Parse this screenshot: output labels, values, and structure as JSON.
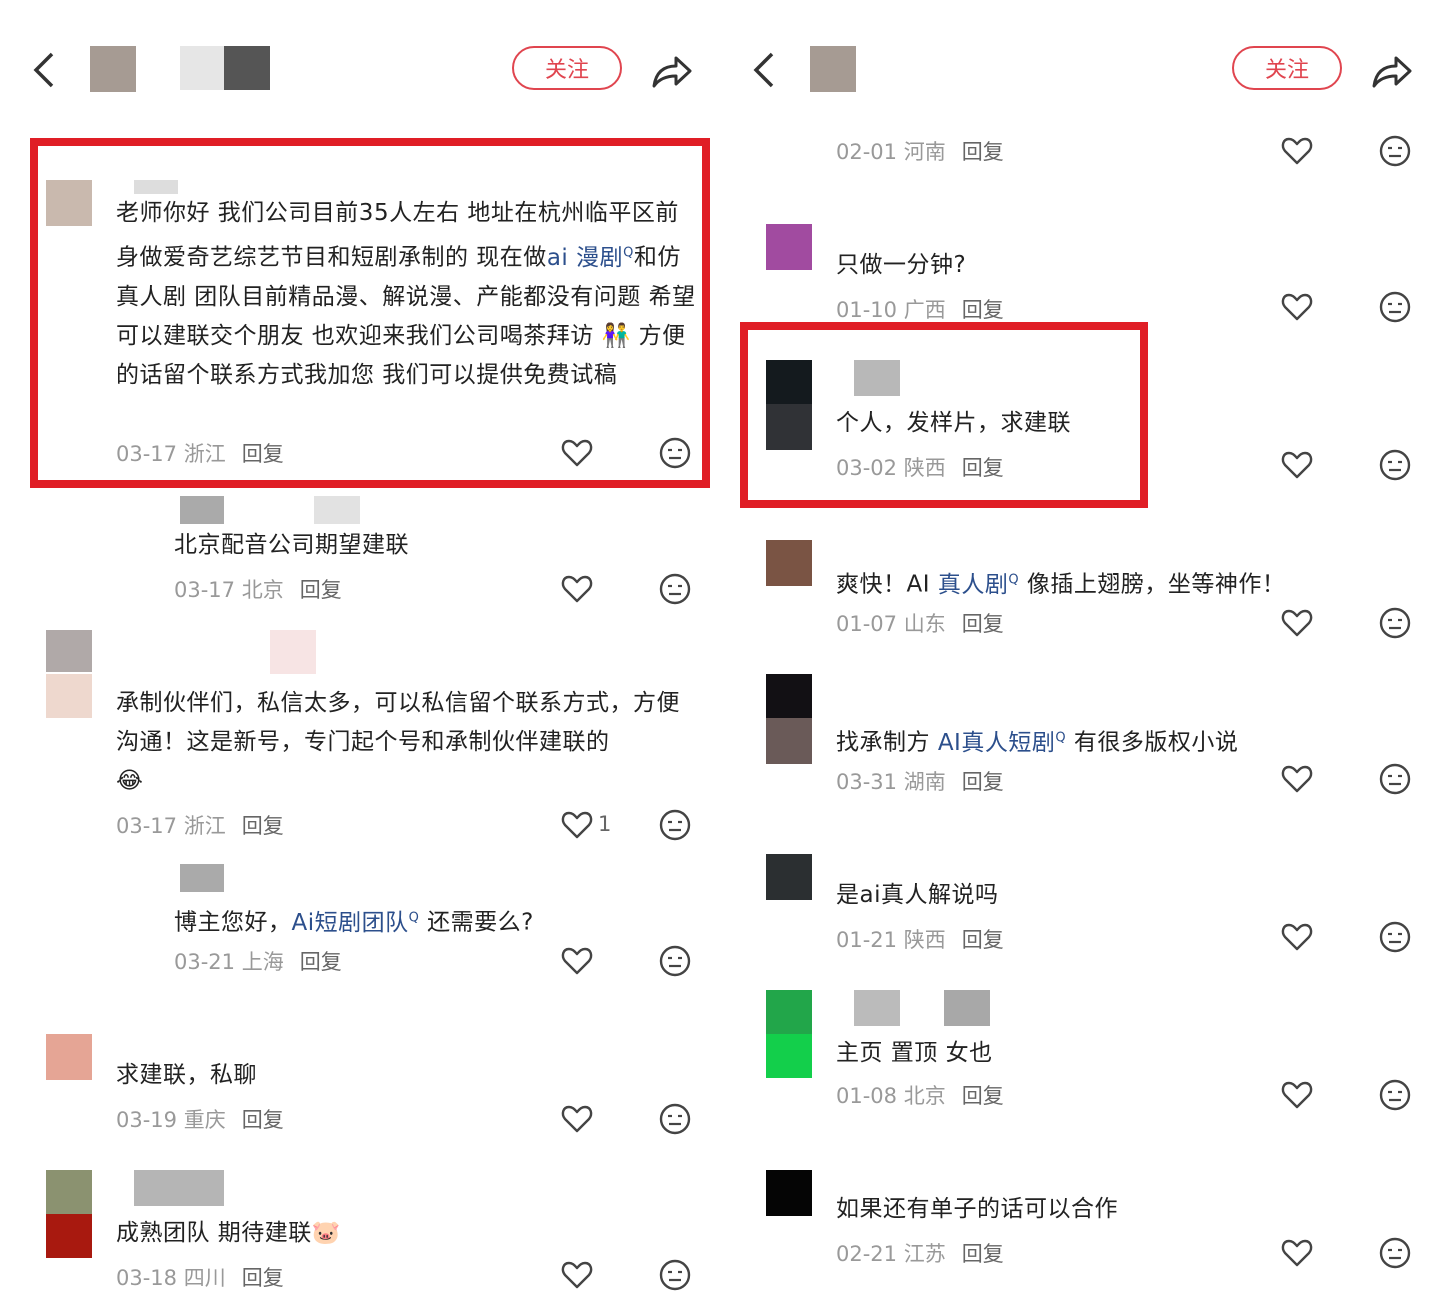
{
  "header": {
    "follow_label": "关注"
  },
  "left": {
    "comments": [
      {
        "text": "老师你好 我们公司目前35人左右 地址在杭州临平区前身做爱奇艺综艺节目和短剧承制的 现在做",
        "link": "ai 漫剧",
        "text_after": "和仿真人剧 团队目前精品漫、解说漫、产能都没有问题 希望可以建联交个朋友 也欢迎来我们公司喝茶拜访 👫 方便的话留个联系方式我加您 我们可以提供免费试稿",
        "date": "03-17",
        "region": "浙江",
        "reply": "回复"
      },
      {
        "text": "北京配音公司期望建联",
        "date": "03-17",
        "region": "北京",
        "reply": "回复"
      },
      {
        "text": "承制伙伴们，私信太多，可以私信留个联系方式，方便沟通！这是新号，专门起个号和承制伙伴建联的",
        "emoji": "😂",
        "date": "03-17",
        "region": "浙江",
        "reply": "回复",
        "likes": "1"
      },
      {
        "text_before": "博主您好，",
        "link": "Ai短剧团队",
        "text_after": " 还需要么?",
        "date": "03-21",
        "region": "上海",
        "reply": "回复"
      },
      {
        "text": "求建联，私聊",
        "date": "03-19",
        "region": "重庆",
        "reply": "回复"
      },
      {
        "text": "成熟团队 期待建联",
        "emoji": "🐷",
        "date": "03-18",
        "region": "四川",
        "reply": "回复"
      }
    ]
  },
  "right": {
    "comments": [
      {
        "date": "02-01",
        "region": "河南",
        "reply": "回复"
      },
      {
        "text": "只做一分钟?",
        "date": "01-10",
        "region": "广西",
        "reply": "回复"
      },
      {
        "text": "个人，发样片，求建联",
        "date": "03-02",
        "region": "陕西",
        "reply": "回复"
      },
      {
        "text_before": "爽快！AI ",
        "link": "真人剧",
        "text_after": " 像插上翅膀，坐等神作！",
        "date": "01-07",
        "region": "山东",
        "reply": "回复"
      },
      {
        "text_before": "找承制方 ",
        "link": "AI真人短剧",
        "text_after": " 有很多版权小说",
        "date": "03-31",
        "region": "湖南",
        "reply": "回复"
      },
      {
        "text": "是ai真人解说吗",
        "date": "01-21",
        "region": "陕西",
        "reply": "回复"
      },
      {
        "text": "主页 置顶 女也",
        "date": "01-08",
        "region": "北京",
        "reply": "回复"
      },
      {
        "text": "如果还有单子的话可以合作",
        "date": "02-21",
        "region": "江苏",
        "reply": "回复"
      }
    ]
  },
  "icons": {
    "back": "chevron-left-icon",
    "share": "share-icon",
    "heart": "heart-icon",
    "face": "emoji-face-icon",
    "search_sup": "search-icon"
  },
  "colors": {
    "accent": "#e0454f",
    "highlight_box": "#e01e26",
    "link": "#2c4f8c"
  }
}
